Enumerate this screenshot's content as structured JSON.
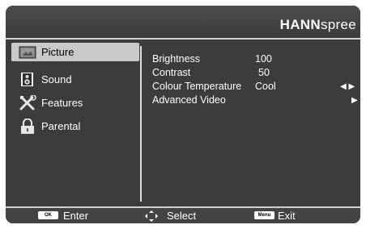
{
  "brand": {
    "bold": "HANN",
    "light": "spree"
  },
  "sidebar": {
    "items": [
      {
        "label": "Picture",
        "icon": "picture-icon",
        "selected": true
      },
      {
        "label": "Sound",
        "icon": "speaker-icon",
        "selected": false
      },
      {
        "label": "Features",
        "icon": "tools-icon",
        "selected": false
      },
      {
        "label": "Parental",
        "icon": "lock-icon",
        "selected": false
      }
    ]
  },
  "settings": [
    {
      "label": "Brightness",
      "value": "100"
    },
    {
      "label": "Contrast",
      "value": "50"
    },
    {
      "label": "Colour Temperature",
      "value": "Cool",
      "control": "left-right-arrows"
    },
    {
      "label": "Advanced Video",
      "value": "",
      "control": "right-arrow"
    }
  ],
  "footer": {
    "enter_key": "OK",
    "enter_label": "Enter",
    "select_label": "Select",
    "exit_key": "Menu",
    "exit_label": "Exit"
  },
  "colors": {
    "panel": "#3c3c3c",
    "selected": "#c9c9c9",
    "text": "#ffffff"
  }
}
